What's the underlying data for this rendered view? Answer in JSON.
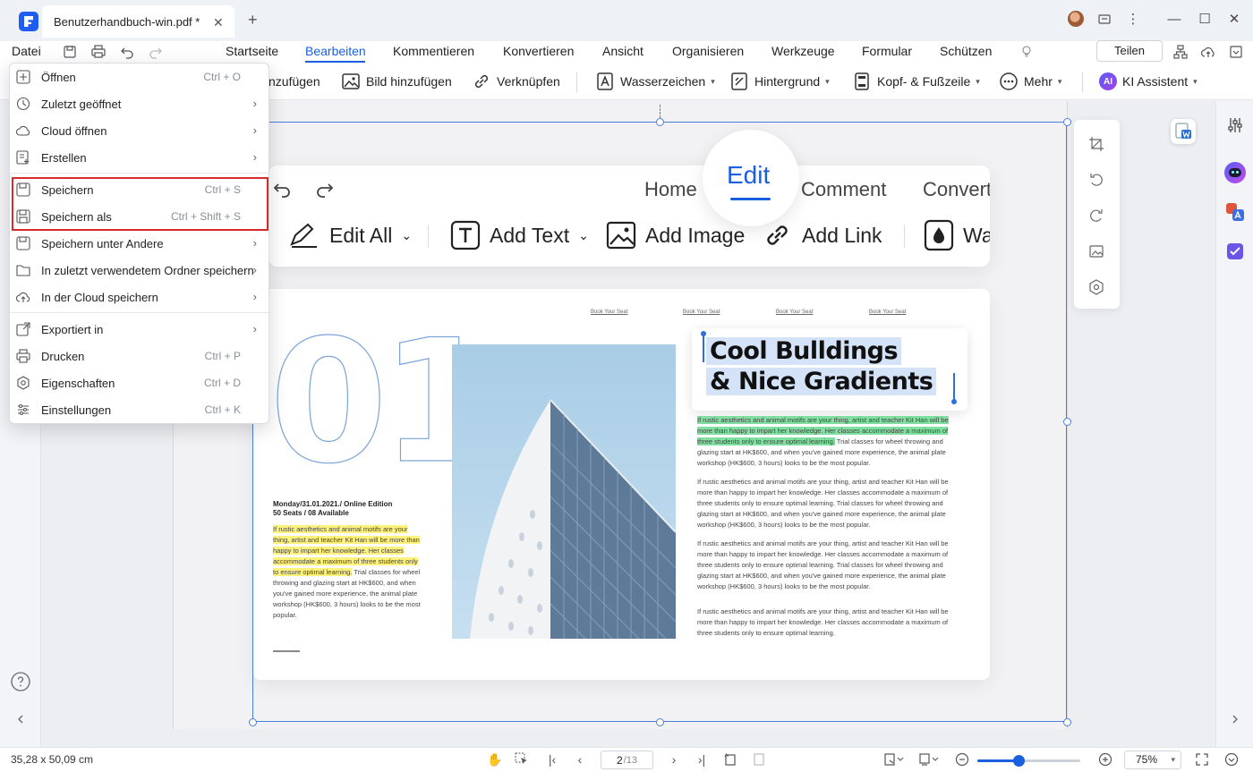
{
  "window": {
    "tab_title": "Benutzerhandbuch-win.pdf *",
    "tab_close": "✕",
    "new_tab": "+"
  },
  "menubar": {
    "file": "Datei",
    "tabs": [
      "Startseite",
      "Bearbeiten",
      "Kommentieren",
      "Konvertieren",
      "Ansicht",
      "Organisieren",
      "Werkzeuge",
      "Formular",
      "Schützen"
    ],
    "active_tab": "Bearbeiten",
    "share": "Teilen"
  },
  "toolbar": {
    "partial_first": "nzufügen",
    "add_image": "Bild hinzufügen",
    "link": "Verknüpfen",
    "watermark": "Wasserzeichen",
    "background": "Hintergrund",
    "header_footer": "Kopf- & Fußzeile",
    "more": "Mehr",
    "ai_badge": "AI",
    "ai_assistant": "KI Assistent"
  },
  "file_menu": {
    "items": [
      {
        "label": "Öffnen",
        "shortcut": "Ctrl + O",
        "submenu": false
      },
      {
        "label": "Zuletzt geöffnet",
        "shortcut": "",
        "submenu": true
      },
      {
        "label": "Cloud öffnen",
        "shortcut": "",
        "submenu": true
      },
      {
        "label": "Erstellen",
        "shortcut": "",
        "submenu": true
      },
      {
        "label": "Speichern",
        "shortcut": "Ctrl + S",
        "submenu": false
      },
      {
        "label": "Speichern als",
        "shortcut": "Ctrl + Shift + S",
        "submenu": false
      },
      {
        "label": "Speichern unter Andere",
        "shortcut": "",
        "submenu": true
      },
      {
        "label": "In zuletzt verwendetem Ordner speichern",
        "shortcut": "",
        "submenu": true
      },
      {
        "label": "In der Cloud speichern",
        "shortcut": "",
        "submenu": true
      },
      {
        "label": "Exportiert in",
        "shortcut": "",
        "submenu": true
      },
      {
        "label": "Drucken",
        "shortcut": "Ctrl + P",
        "submenu": false
      },
      {
        "label": "Eigenschaften",
        "shortcut": "Ctrl + D",
        "submenu": false
      },
      {
        "label": "Einstellungen",
        "shortcut": "Ctrl + K",
        "submenu": false
      }
    ],
    "arrow": "›"
  },
  "page_content": {
    "mock_tabs": {
      "home": "Home",
      "edit": "Edit",
      "comment": "Comment",
      "convert": "Convert"
    },
    "mock_tools": {
      "edit_all": "Edit All",
      "add_text": "Add Text",
      "add_image": "Add Image",
      "add_link": "Add Link",
      "wa": "Wa"
    },
    "seat_links": [
      "Book Your Seat",
      "Book Your Seat",
      "Book Your Seat",
      "Book Your Seat"
    ],
    "big_number": "01",
    "heading": [
      "Cool Bulldings",
      "& Nice Gradients"
    ],
    "event_line1": "Monday/31.01.2021./ Online Edition",
    "event_line2": "50 Seats / 08 Available",
    "left_para_highlight": "If rustic aesthetics and animal motifs are your thing, artist and teacher Kit Han will be more than happy to impart her knowledge. Her classes accommodate a maximum of three students only to ensure optimal learning.",
    "left_para_rest": " Trial classes for wheel throwing and glazing start at HK$600, and when you've gained more experience, the animal plate workshop (HK$600, 3 hours) looks to be the most popular.",
    "right_para_highlight": "If rustic aesthetics and animal motifs are your thing, artist and teacher Kit Han will be more than happy to impart her knowledge. Her classes accommodate a maximum of three students only to ensure optimal learning.",
    "right_para_rest": " Trial classes for wheel throwing and glazing start at HK$600, and when you've gained more experience, the animal plate workshop (HK$600, 3 hours) looks to be the most popular.",
    "paragraph": "If rustic aesthetics and animal motifs are your thing, artist and teacher Kit Han will be more than happy to impart her knowledge. Her classes accommodate a maximum of three students only to ensure optimal learning. Trial classes for wheel throwing and glazing start at HK$600, and when you've gained more experience, the animal plate workshop (HK$600, 3 hours) looks to be the most popular.",
    "last_paragraph": "If rustic aesthetics and animal motifs are your thing, artist and teacher Kit Han will be more than happy to impart her knowledge. Her classes accommodate a maximum of three students only to ensure optimal learning."
  },
  "statusbar": {
    "dimensions": "35,28 x 50,09 cm",
    "current_page": "2",
    "total_pages": "/13",
    "zoom": "75%",
    "zoom_level": 0.4
  },
  "colors": {
    "accent": "#1a5fe0",
    "highlight_border": "#d72a2a"
  }
}
